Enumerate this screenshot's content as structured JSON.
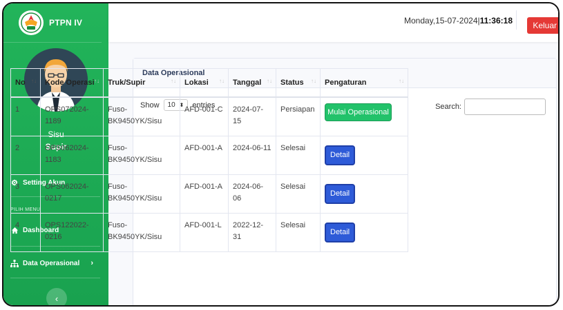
{
  "brand": {
    "title": "PTPN IV"
  },
  "user": {
    "name": "Sisu",
    "role": "Supir"
  },
  "sidebar": {
    "setting_account": "Setting Akun",
    "menu_heading": "PILIH MENU",
    "items": [
      {
        "label": "Dashboard",
        "icon": "home-icon"
      },
      {
        "label": "Data Operasional",
        "icon": "sitemap-icon"
      }
    ]
  },
  "topbar": {
    "date": "Monday,15-07-2024|",
    "time": "11:36:18",
    "logout_label": "Keluar"
  },
  "card": {
    "title": "Data Operasional"
  },
  "controls": {
    "show_label": "Show",
    "entries_value": "10",
    "entries_label": "entries",
    "search_label": "Search:"
  },
  "table": {
    "headers": [
      "No",
      "Kode Operasi",
      "Truk/Supir",
      "Lokasi",
      "Tanggal",
      "Status",
      "Pengaturan"
    ],
    "rows": [
      {
        "no": "1",
        "kode": "OPS072024-1189",
        "truk": "Fuso-BK9450YK/Sisu",
        "lokasi": "AFD-001-C",
        "tanggal": "2024-07-15",
        "status": "Persiapan",
        "action": "Mulai Operasional"
      },
      {
        "no": "2",
        "kode": "OPS062024-1183",
        "truk": "Fuso-BK9450YK/Sisu",
        "lokasi": "AFD-001-A",
        "tanggal": "2024-06-11",
        "status": "Selesai",
        "action": "Detail"
      },
      {
        "no": "3",
        "kode": "OPS062024-0217",
        "truk": "Fuso-BK9450YK/Sisu",
        "lokasi": "AFD-001-A",
        "tanggal": "2024-06-06",
        "status": "Selesai",
        "action": "Detail"
      },
      {
        "no": "4",
        "kode": "OPS122022-0216",
        "truk": "Fuso-BK9450YK/Sisu",
        "lokasi": "AFD-001-L",
        "tanggal": "2022-12-31",
        "status": "Selesai",
        "action": "Detail"
      }
    ]
  },
  "colors": {
    "sidebar_green": "#1fae57",
    "logout_red": "#e53935",
    "primary_blue": "#2e5bd8",
    "success_green": "#22c26a"
  }
}
